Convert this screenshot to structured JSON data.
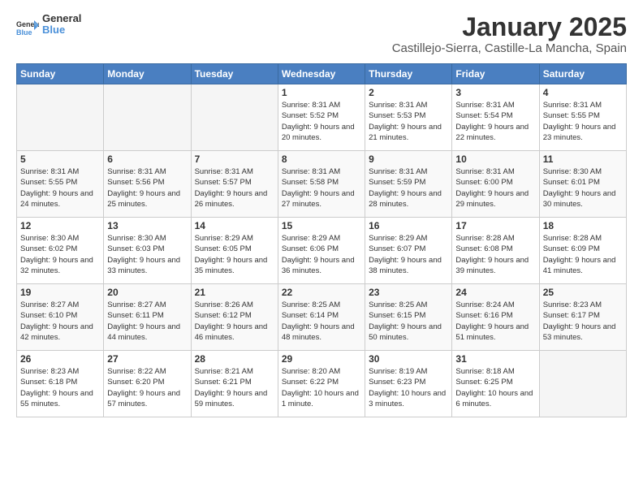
{
  "header": {
    "logo_general": "General",
    "logo_blue": "Blue",
    "month_title": "January 2025",
    "location": "Castillejo-Sierra, Castille-La Mancha, Spain"
  },
  "days_of_week": [
    "Sunday",
    "Monday",
    "Tuesday",
    "Wednesday",
    "Thursday",
    "Friday",
    "Saturday"
  ],
  "weeks": [
    [
      {
        "day": "",
        "empty": true
      },
      {
        "day": "",
        "empty": true
      },
      {
        "day": "",
        "empty": true
      },
      {
        "day": "1",
        "sunrise": "8:31 AM",
        "sunset": "5:52 PM",
        "daylight": "9 hours and 20 minutes."
      },
      {
        "day": "2",
        "sunrise": "8:31 AM",
        "sunset": "5:53 PM",
        "daylight": "9 hours and 21 minutes."
      },
      {
        "day": "3",
        "sunrise": "8:31 AM",
        "sunset": "5:54 PM",
        "daylight": "9 hours and 22 minutes."
      },
      {
        "day": "4",
        "sunrise": "8:31 AM",
        "sunset": "5:55 PM",
        "daylight": "9 hours and 23 minutes."
      }
    ],
    [
      {
        "day": "5",
        "sunrise": "8:31 AM",
        "sunset": "5:55 PM",
        "daylight": "9 hours and 24 minutes."
      },
      {
        "day": "6",
        "sunrise": "8:31 AM",
        "sunset": "5:56 PM",
        "daylight": "9 hours and 25 minutes."
      },
      {
        "day": "7",
        "sunrise": "8:31 AM",
        "sunset": "5:57 PM",
        "daylight": "9 hours and 26 minutes."
      },
      {
        "day": "8",
        "sunrise": "8:31 AM",
        "sunset": "5:58 PM",
        "daylight": "9 hours and 27 minutes."
      },
      {
        "day": "9",
        "sunrise": "8:31 AM",
        "sunset": "5:59 PM",
        "daylight": "9 hours and 28 minutes."
      },
      {
        "day": "10",
        "sunrise": "8:31 AM",
        "sunset": "6:00 PM",
        "daylight": "9 hours and 29 minutes."
      },
      {
        "day": "11",
        "sunrise": "8:30 AM",
        "sunset": "6:01 PM",
        "daylight": "9 hours and 30 minutes."
      }
    ],
    [
      {
        "day": "12",
        "sunrise": "8:30 AM",
        "sunset": "6:02 PM",
        "daylight": "9 hours and 32 minutes."
      },
      {
        "day": "13",
        "sunrise": "8:30 AM",
        "sunset": "6:03 PM",
        "daylight": "9 hours and 33 minutes."
      },
      {
        "day": "14",
        "sunrise": "8:29 AM",
        "sunset": "6:05 PM",
        "daylight": "9 hours and 35 minutes."
      },
      {
        "day": "15",
        "sunrise": "8:29 AM",
        "sunset": "6:06 PM",
        "daylight": "9 hours and 36 minutes."
      },
      {
        "day": "16",
        "sunrise": "8:29 AM",
        "sunset": "6:07 PM",
        "daylight": "9 hours and 38 minutes."
      },
      {
        "day": "17",
        "sunrise": "8:28 AM",
        "sunset": "6:08 PM",
        "daylight": "9 hours and 39 minutes."
      },
      {
        "day": "18",
        "sunrise": "8:28 AM",
        "sunset": "6:09 PM",
        "daylight": "9 hours and 41 minutes."
      }
    ],
    [
      {
        "day": "19",
        "sunrise": "8:27 AM",
        "sunset": "6:10 PM",
        "daylight": "9 hours and 42 minutes."
      },
      {
        "day": "20",
        "sunrise": "8:27 AM",
        "sunset": "6:11 PM",
        "daylight": "9 hours and 44 minutes."
      },
      {
        "day": "21",
        "sunrise": "8:26 AM",
        "sunset": "6:12 PM",
        "daylight": "9 hours and 46 minutes."
      },
      {
        "day": "22",
        "sunrise": "8:25 AM",
        "sunset": "6:14 PM",
        "daylight": "9 hours and 48 minutes."
      },
      {
        "day": "23",
        "sunrise": "8:25 AM",
        "sunset": "6:15 PM",
        "daylight": "9 hours and 50 minutes."
      },
      {
        "day": "24",
        "sunrise": "8:24 AM",
        "sunset": "6:16 PM",
        "daylight": "9 hours and 51 minutes."
      },
      {
        "day": "25",
        "sunrise": "8:23 AM",
        "sunset": "6:17 PM",
        "daylight": "9 hours and 53 minutes."
      }
    ],
    [
      {
        "day": "26",
        "sunrise": "8:23 AM",
        "sunset": "6:18 PM",
        "daylight": "9 hours and 55 minutes."
      },
      {
        "day": "27",
        "sunrise": "8:22 AM",
        "sunset": "6:20 PM",
        "daylight": "9 hours and 57 minutes."
      },
      {
        "day": "28",
        "sunrise": "8:21 AM",
        "sunset": "6:21 PM",
        "daylight": "9 hours and 59 minutes."
      },
      {
        "day": "29",
        "sunrise": "8:20 AM",
        "sunset": "6:22 PM",
        "daylight": "10 hours and 1 minute."
      },
      {
        "day": "30",
        "sunrise": "8:19 AM",
        "sunset": "6:23 PM",
        "daylight": "10 hours and 3 minutes."
      },
      {
        "day": "31",
        "sunrise": "8:18 AM",
        "sunset": "6:25 PM",
        "daylight": "10 hours and 6 minutes."
      },
      {
        "day": "",
        "empty": true
      }
    ]
  ]
}
